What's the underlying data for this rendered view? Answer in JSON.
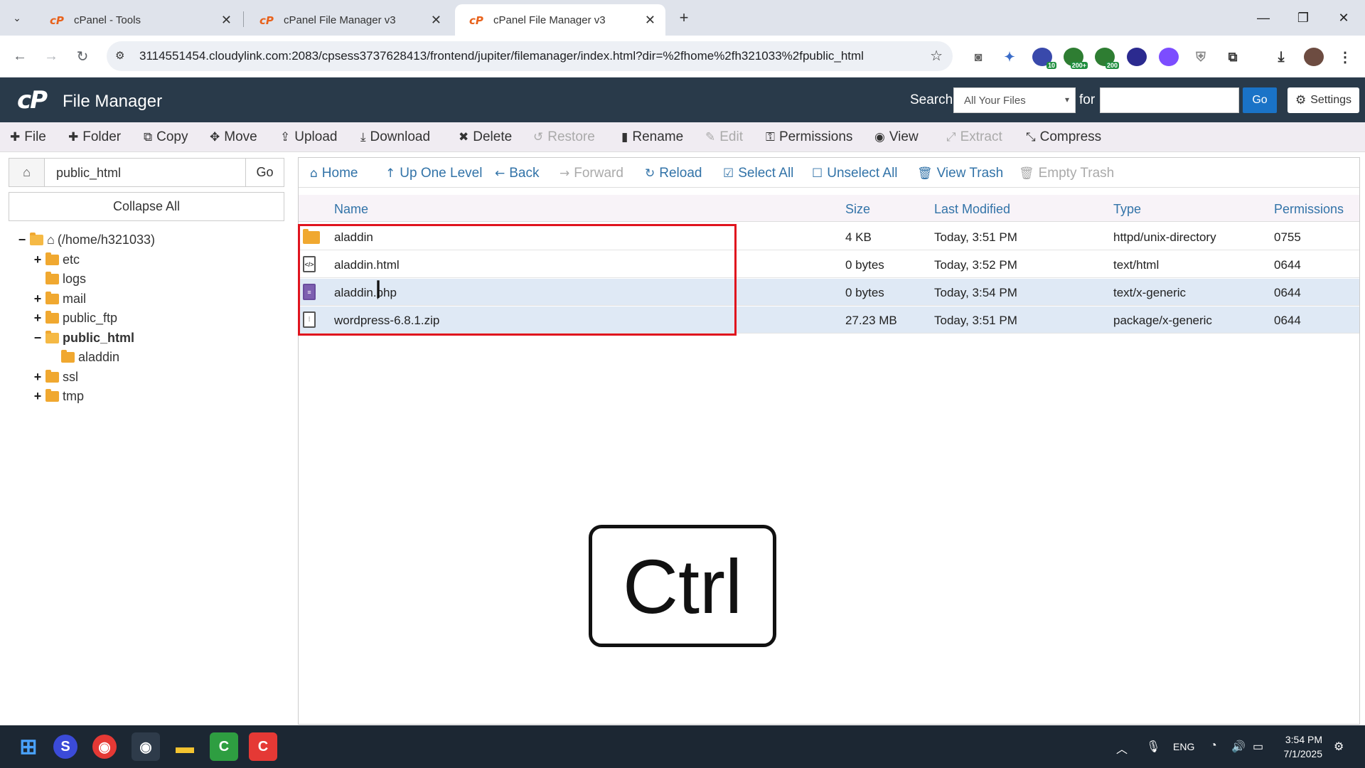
{
  "browser": {
    "tabs": [
      {
        "title": "cPanel - Tools"
      },
      {
        "title": "cPanel File Manager v3"
      },
      {
        "title": "cPanel File Manager v3"
      }
    ],
    "url": "3114551454.cloudylink.com:2083/cpsess3737628413/frontend/jupiter/filemanager/index.html?dir=%2fhome%2fh321033%2fpublic_html",
    "extensions": [
      {
        "icon": "camera-icon"
      },
      {
        "icon": "wand-icon"
      },
      {
        "icon": "extension-icon",
        "badge": "10"
      },
      {
        "icon": "extension-icon",
        "badge": "200+"
      },
      {
        "icon": "extension-icon",
        "badge": "200"
      },
      {
        "icon": "extension-icon"
      },
      {
        "icon": "extension-icon"
      },
      {
        "icon": "shield-icon"
      },
      {
        "icon": "puzzle-icon"
      }
    ]
  },
  "header": {
    "title": "File Manager",
    "search_label": "Search",
    "search_scope": "All Your Files",
    "for_label": "for",
    "search_value": "",
    "go_label": "Go",
    "settings_label": "Settings"
  },
  "toolbar": {
    "items": [
      {
        "label": "File",
        "icon": "plus-icon",
        "enabled": true
      },
      {
        "label": "Folder",
        "icon": "plus-icon",
        "enabled": true
      },
      {
        "label": "Copy",
        "icon": "copy-icon",
        "enabled": true
      },
      {
        "label": "Move",
        "icon": "move-icon",
        "enabled": true
      },
      {
        "label": "Upload",
        "icon": "upload-icon",
        "enabled": true
      },
      {
        "label": "Download",
        "icon": "download-icon",
        "enabled": true
      },
      {
        "label": "Delete",
        "icon": "close-icon",
        "enabled": true
      },
      {
        "label": "Restore",
        "icon": "undo-icon",
        "enabled": false
      },
      {
        "label": "Rename",
        "icon": "file-icon",
        "enabled": true
      },
      {
        "label": "Edit",
        "icon": "pencil-icon",
        "enabled": false
      },
      {
        "label": "Permissions",
        "icon": "key-icon",
        "enabled": true
      },
      {
        "label": "View",
        "icon": "eye-icon",
        "enabled": true
      },
      {
        "label": "Extract",
        "icon": "expand-icon",
        "enabled": false
      },
      {
        "label": "Compress",
        "icon": "compress-icon",
        "enabled": true
      }
    ]
  },
  "sidebar": {
    "path_value": "public_html",
    "go_label": "Go",
    "collapse_label": "Collapse All",
    "tree": [
      {
        "label": "(/home/h321033)",
        "toggle": "−",
        "bold": false
      },
      {
        "label": "etc",
        "toggle": "+",
        "bold": false
      },
      {
        "label": "logs",
        "toggle": "",
        "bold": false
      },
      {
        "label": "mail",
        "toggle": "+",
        "bold": false
      },
      {
        "label": "public_ftp",
        "toggle": "+",
        "bold": false
      },
      {
        "label": "public_html",
        "toggle": "−",
        "bold": true
      },
      {
        "label": "aladdin",
        "toggle": "",
        "bold": false
      },
      {
        "label": "ssl",
        "toggle": "+",
        "bold": false
      },
      {
        "label": "tmp",
        "toggle": "+",
        "bold": false
      }
    ]
  },
  "navbar": {
    "items": [
      {
        "label": "Home",
        "icon": "home-icon",
        "enabled": true
      },
      {
        "label": "Up One Level",
        "icon": "arrow-up-icon",
        "enabled": true
      },
      {
        "label": "Back",
        "icon": "arrow-left-icon",
        "enabled": true
      },
      {
        "label": "Forward",
        "icon": "arrow-right-icon",
        "enabled": false
      },
      {
        "label": "Reload",
        "icon": "refresh-icon",
        "enabled": true
      },
      {
        "label": "Select All",
        "icon": "checkbox-checked-icon",
        "enabled": true
      },
      {
        "label": "Unselect All",
        "icon": "checkbox-icon",
        "enabled": true
      },
      {
        "label": "View Trash",
        "icon": "trash-icon",
        "enabled": true
      },
      {
        "label": "Empty Trash",
        "icon": "trash-icon",
        "enabled": false
      }
    ]
  },
  "files": {
    "columns": [
      "Name",
      "Size",
      "Last Modified",
      "Type",
      "Permissions"
    ],
    "rows": [
      {
        "name": "aladdin",
        "size": "4 KB",
        "modified": "Today, 3:51 PM",
        "type": "httpd/unix-directory",
        "perms": "0755",
        "icon": "folder-icon",
        "selected": false
      },
      {
        "name": "aladdin.html",
        "size": "0 bytes",
        "modified": "Today, 3:52 PM",
        "type": "text/html",
        "perms": "0644",
        "icon": "html-file-icon",
        "selected": false
      },
      {
        "name": "aladdin.php",
        "size": "0 bytes",
        "modified": "Today, 3:54 PM",
        "type": "text/x-generic",
        "perms": "0644",
        "icon": "text-file-icon",
        "selected": true
      },
      {
        "name": "wordpress-6.8.1.zip",
        "size": "27.23 MB",
        "modified": "Today, 3:51 PM",
        "type": "package/x-generic",
        "perms": "0644",
        "icon": "zip-file-icon",
        "selected": true
      }
    ]
  },
  "overlay": {
    "key_label": "Ctrl"
  },
  "taskbar": {
    "tray_language": "ENG",
    "time": "3:54 PM",
    "date": "7/1/2025"
  },
  "colors": {
    "header_bg": "#293a4a",
    "toolbar_bg": "#f0ecf2",
    "link_blue": "#3273a8",
    "selection_bg": "#dfe9f5",
    "highlight_red": "#e0141e"
  }
}
